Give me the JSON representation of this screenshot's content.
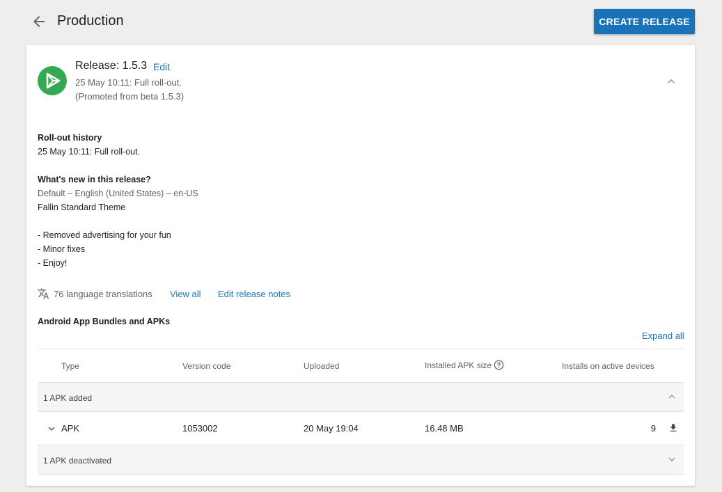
{
  "header": {
    "title": "Production",
    "create_label": "CREATE RELEASE"
  },
  "release": {
    "title": "Release: 1.5.3",
    "edit_label": "Edit",
    "status": "25 May 10:11: Full roll-out.",
    "promoted": "(Promoted from beta 1.5.3)"
  },
  "rollout": {
    "heading": "Roll-out history",
    "entry": "25 May 10:11: Full roll-out."
  },
  "whats_new": {
    "heading": "What's new in this release?",
    "locale": "Default – English (United States) – en-US",
    "lines": [
      "Fallin Standard Theme",
      "- Removed advertising for your fun",
      "- Minor fixes",
      "- Enjoy!"
    ]
  },
  "translations": {
    "count_label": "76 language translations",
    "view_all": "View all",
    "edit_notes": "Edit release notes"
  },
  "bundles": {
    "heading": "Android App Bundles and APKs",
    "expand_all": "Expand all",
    "columns": [
      "Type",
      "Version code",
      "Uploaded",
      "Installed APK size",
      "Installs on active devices"
    ],
    "groups": [
      {
        "label": "1 APK added",
        "rows": [
          {
            "type": "APK",
            "version_code": "1053002",
            "uploaded": "20 May 19:04",
            "size": "16.48 MB",
            "installs": "9"
          }
        ]
      },
      {
        "label": "1 APK deactivated",
        "rows": []
      }
    ]
  },
  "icons": {
    "back": "arrow-back-icon",
    "logo": "play-logo-icon",
    "collapse": "chevron-up-icon",
    "translate": "translate-icon",
    "help": "help-circle-icon",
    "download": "download-icon"
  },
  "colors": {
    "accent": "#1a73b8",
    "logo": "#34a853",
    "background": "#eeeeee"
  }
}
